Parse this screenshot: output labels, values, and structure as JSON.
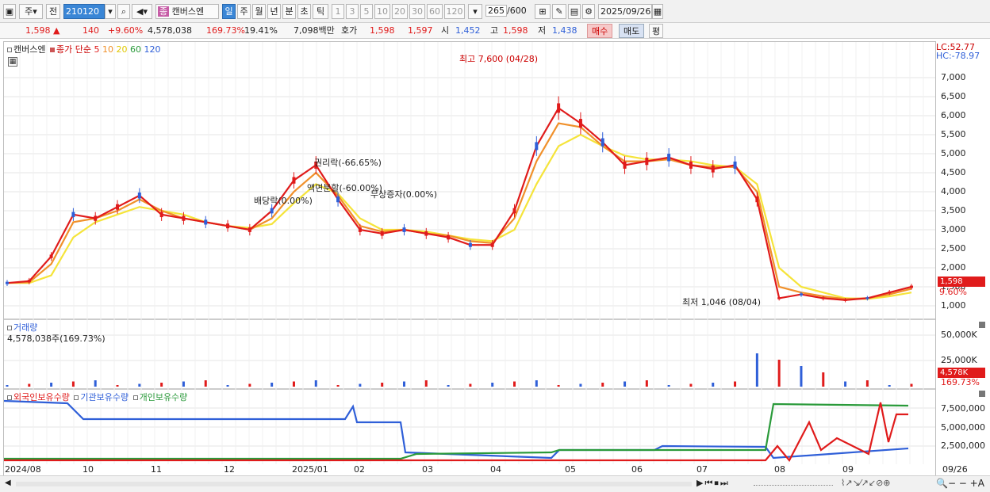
{
  "toolbar": {
    "period_kind": "주",
    "prev_label": "전",
    "code": "210120",
    "stock_name": "캔버스엔",
    "periods": [
      "일",
      "주",
      "월",
      "년",
      "분",
      "초",
      "틱"
    ],
    "selected_period": "일",
    "intervals": [
      "1",
      "3",
      "5",
      "10",
      "20",
      "30",
      "60",
      "120"
    ],
    "count": "265",
    "count_total": "/600",
    "date": "2025/09/26"
  },
  "info": {
    "price": "1,598",
    "change": "140",
    "change_pct": "+9.60%",
    "volume": "4,578,038",
    "volume_ratio": "169.73%",
    "turnover": "19.41%",
    "amount": "7,098백만",
    "ask_label": "호가",
    "ask": "1,598",
    "bid": "1,597",
    "open_label": "시",
    "open": "1,452",
    "high_label": "고",
    "high": "1,598",
    "low_label": "저",
    "low": "1,438",
    "buy_label": "매수",
    "sell_label": "매도",
    "eval_label": "평"
  },
  "price_panel": {
    "name": "캔버스엔",
    "ma_label": "종가 단순",
    "ma_periods": [
      "5",
      "10",
      "20",
      "60",
      "120"
    ],
    "ma_colors": {
      "5": "#e01b1b",
      "10": "#f0902a",
      "20": "#f5e43a",
      "60": "#2a9a3a",
      "120": "#2f5fd8"
    },
    "lc": "LC:52.77",
    "hc": "HC:-78.97",
    "yticks": [
      "7,000",
      "6,500",
      "6,000",
      "5,500",
      "5,000",
      "4,500",
      "4,000",
      "3,500",
      "3,000",
      "2,500",
      "2,000",
      "1,500",
      "1,000"
    ],
    "last_price_tag": "1,598",
    "last_pct_tag": "9.60%",
    "annotations": {
      "high": "최고 7,600 (04/28)",
      "low": "최저 1,046 (08/04)",
      "rights": "권리락(-66.65%)",
      "split": "액면분할(-60.00%)",
      "dividend": "배당락(0.00%)",
      "capital": "무상증자(0.00%)"
    }
  },
  "volume_panel": {
    "title": "거래량",
    "value": "4,578,038주(169.73%)",
    "yticks": [
      "50,000K",
      "25,000K"
    ],
    "tag": "4,578K",
    "tag_pct": "169.73%"
  },
  "holdings_panel": {
    "series": [
      "외국인보유수량",
      "기관보유수량",
      "개인보유수량"
    ],
    "series_colors": [
      "#e01b1b",
      "#2f5fd8",
      "#2a9a3a"
    ],
    "yticks": [
      "7,500,000",
      "5,000,000",
      "2,500,000"
    ]
  },
  "x_labels": [
    "2024/08",
    "10",
    "11",
    "12",
    "2025/01",
    "02",
    "03",
    "04",
    "05",
    "06",
    "07",
    "08",
    "09",
    "09/26"
  ],
  "chart_data": {
    "type": "line",
    "series": [
      {
        "name": "5",
        "values": [
          1600,
          1650,
          2300,
          3400,
          3300,
          3600,
          3900,
          3400,
          3300,
          3200,
          3100,
          3000,
          3500,
          4300,
          4700,
          3800,
          3000,
          2900,
          3000,
          2900,
          2800,
          2600,
          2600,
          3500,
          5200,
          6200,
          5800,
          5300,
          4700,
          4800,
          4900,
          4700,
          4600,
          4700,
          3800,
          1200,
          1300,
          1200,
          1150,
          1200,
          1350,
          1500
        ]
      },
      {
        "name": "10",
        "values": [
          1600,
          1620,
          2100,
          3200,
          3300,
          3500,
          3800,
          3500,
          3300,
          3200,
          3100,
          3000,
          3300,
          4000,
          4500,
          3900,
          3100,
          2950,
          3000,
          2900,
          2850,
          2700,
          2650,
          3300,
          4800,
          5800,
          5700,
          5200,
          4800,
          4800,
          4850,
          4700,
          4650,
          4650,
          4000,
          1500,
          1350,
          1250,
          1180,
          1200,
          1300,
          1450
        ]
      },
      {
        "name": "20",
        "values": [
          1600,
          1600,
          1800,
          2800,
          3200,
          3400,
          3600,
          3500,
          3400,
          3200,
          3100,
          3050,
          3150,
          3700,
          4200,
          3950,
          3300,
          3000,
          3000,
          2950,
          2850,
          2750,
          2700,
          3000,
          4200,
          5200,
          5500,
          5200,
          4950,
          4850,
          4850,
          4800,
          4700,
          4650,
          4200,
          2000,
          1500,
          1350,
          1200,
          1180,
          1250,
          1350
        ]
      }
    ]
  }
}
